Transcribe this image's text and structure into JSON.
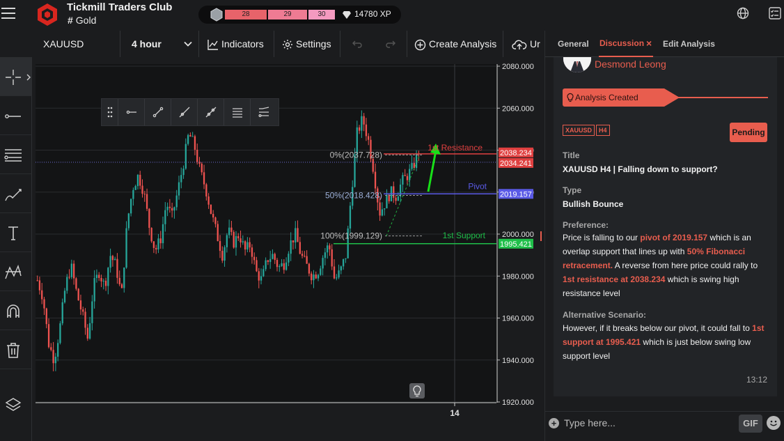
{
  "app": {
    "title": "Tickmill Traders Club",
    "subtitle": "Gold",
    "hash": "#"
  },
  "xp": {
    "levels": [
      "28",
      "29",
      "30"
    ],
    "points": "14780 XP"
  },
  "toolbar": {
    "symbol": "XAUUSD",
    "timeframe": "4 hour",
    "indicators": "Indicators",
    "settings": "Settings",
    "create_analysis": "Create Analysis",
    "upload": "Ur"
  },
  "left_rail": {
    "tools": [
      "crosshair-icon",
      "horizontal-line-icon",
      "fibonacci-icon",
      "brush-icon",
      "text-icon",
      "pattern-icon",
      "magnet-icon",
      "trash-icon",
      "layers-icon"
    ]
  },
  "chart": {
    "symbol": "XAUUSD",
    "price_ticks": [
      "2080.000",
      "2060.000",
      "2040.000",
      "2020.000",
      "2000.000",
      "1980.000",
      "1960.000",
      "1940.000",
      "1920.000"
    ],
    "x_tick": "14",
    "price_tags": [
      {
        "value": "2038.234",
        "color": "#e04040"
      },
      {
        "value": "2034.241",
        "color": "#e04040"
      },
      {
        "value": "2019.157",
        "color": "#5a5ae6"
      },
      {
        "value": "1995.421",
        "color": "#1fbf4a"
      }
    ],
    "levels": {
      "resistance_label": "1st Resistance",
      "pivot_label": "Pivot",
      "support_label": "1st Support",
      "fib_0": "0%(2037.728)",
      "fib_50": "50%(2018.428)",
      "fib_100": "100%(1999.129)"
    },
    "colors": {
      "bull": "#26a69a",
      "bear": "#ef5350",
      "resistance": "#e04040",
      "pivot": "#5a5ae6",
      "support": "#1fbf4a",
      "arrow": "#18e018"
    }
  },
  "chart_data": {
    "type": "candlestick",
    "title": "XAUUSD",
    "timeframe": "4 hour",
    "ylim": [
      1920,
      2080
    ],
    "resistance": 2038.234,
    "last_price": 2034.241,
    "pivot": 2019.157,
    "support": 1995.421,
    "fib": {
      "0": 2037.728,
      "50": 2018.428,
      "100": 1999.129
    },
    "price_path": [
      1978,
      1970,
      1948,
      1940,
      1955,
      1975,
      1985,
      1972,
      1962,
      1950,
      1975,
      1982,
      1975,
      1990,
      1985,
      1970,
      2005,
      2022,
      2028,
      2020,
      2003,
      1992,
      1998,
      2015,
      2008,
      2020,
      2033,
      2048,
      2042,
      2030,
      2022,
      2010,
      2000,
      1990,
      2002,
      1996,
      2000,
      1992,
      1995,
      1982,
      1978,
      1988,
      1990,
      1984,
      1986,
      1995,
      2000,
      1990,
      1985,
      1980,
      1982,
      1990,
      1995,
      1978,
      1982,
      1990,
      2020,
      2048,
      2055,
      2045,
      2030,
      2010,
      2015,
      2020,
      2018,
      2025,
      2028,
      2032,
      2040
    ]
  },
  "panel": {
    "tabs": [
      "General",
      "Discussion",
      "Edit Analysis"
    ],
    "close": "×",
    "author": "Desmond Leong",
    "banner": "Analysis Created",
    "tags": [
      "XAUUSD",
      "H4"
    ],
    "status": "Pending",
    "title_label": "Title",
    "title_value": "XAUUSD H4 | Falling down to support?",
    "type_label": "Type",
    "type_value": "Bullish Bounce",
    "preference_label": "Preference:",
    "preference": {
      "t1": "Price is falling to our ",
      "h1": "pivot of 2019.157",
      "t2": " which is an overlap support that lines up with ",
      "h2": "50% Fibonacci retracement.",
      "t3": " A reverse from here price could rally to ",
      "h3": "1st resistance at 2038.234",
      "t4": " which is swing high resistance level"
    },
    "alt_label": "Alternative Scenario:",
    "alternative": {
      "t1": "However, if it breaks below our pivot, it could fall to ",
      "h1": "1st support at 1995.421",
      "t2": " which is just below swing low support level"
    },
    "time": "13:12",
    "input_placeholder": "Type here...",
    "gif": "GIF",
    "plus": "+"
  }
}
